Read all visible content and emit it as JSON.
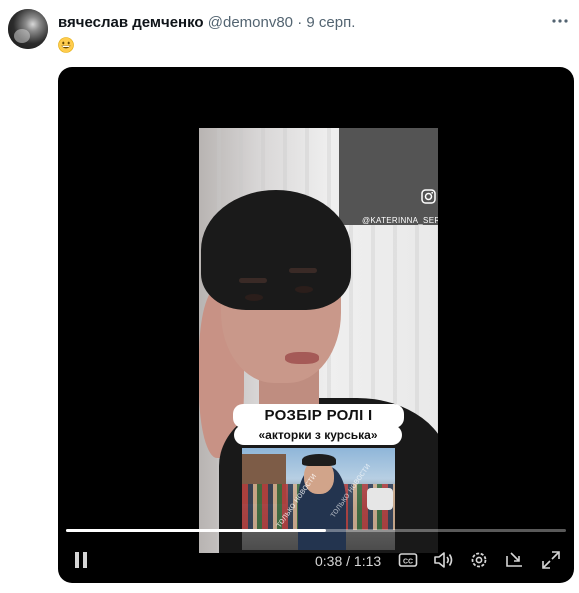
{
  "tweet": {
    "author_name": "вячеслав демченко",
    "handle": "@demonv80",
    "separator": "·",
    "date": "9 серп.",
    "emoji": "grinning-face-emoji"
  },
  "video": {
    "watermark": "@KATERINNA_SERGEEVA",
    "caption_line1": "РОЗБІР РОЛІ І ГОЛОСУ",
    "caption_line2": "«акторки з курська»",
    "inset_watermark": "только новости",
    "progress": 0.52,
    "time": "0:38 / 1:13",
    "icons": [
      "pause-icon",
      "captions-icon",
      "volume-icon",
      "settings-icon",
      "picture-in-picture-icon",
      "fullscreen-icon"
    ]
  },
  "colors": {
    "text_primary": "#0f1419",
    "text_secondary": "#536471",
    "video_bg": "#000000"
  }
}
